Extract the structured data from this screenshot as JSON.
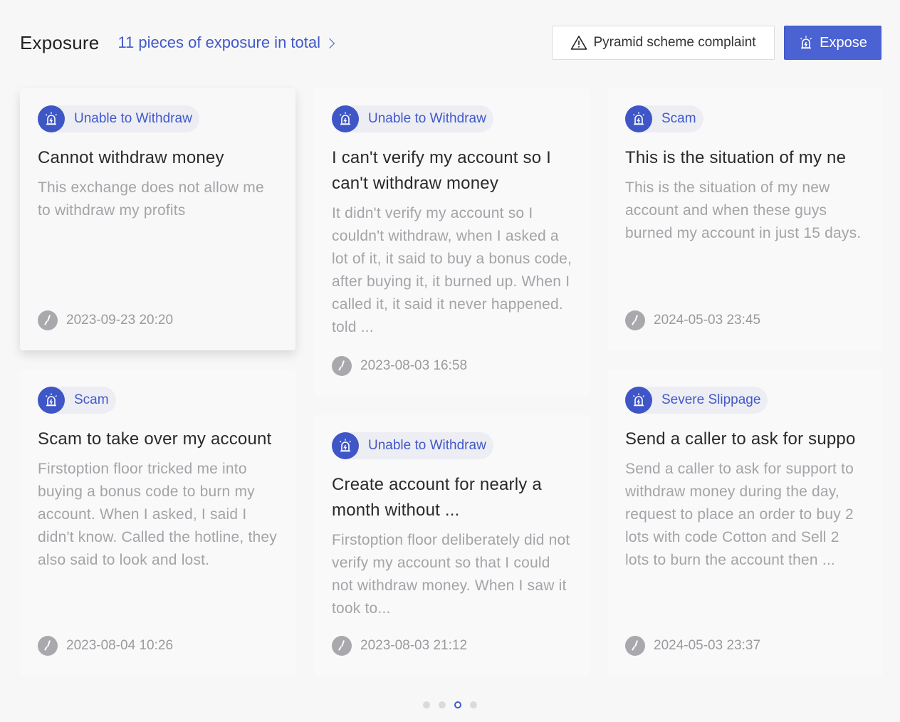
{
  "header": {
    "title": "Exposure",
    "total_link": "11 pieces of exposure in total",
    "complaint_button": "Pyramid scheme complaint",
    "expose_button": "Expose"
  },
  "cards": [
    {
      "tag": "Unable to Withdraw",
      "title": "Cannot withdraw money",
      "desc": "This exchange does not allow me to withdraw my profits",
      "time": "2023-09-23 20:20"
    },
    {
      "tag": "Scam",
      "title": "Scam to take over my account",
      "desc": "Firstoption floor tricked me into buying a bonus code to burn my account. When I asked, I said I didn't know. Called the hotline, they also said to look and lost.",
      "time": "2023-08-04 10:26"
    },
    {
      "tag": "Unable to Withdraw",
      "title": "I can't verify my account so I can't withdraw money",
      "desc": "It didn't verify my account so I couldn't withdraw, when I asked a lot of it, it said to buy a bonus code, after buying it, it burned up. When I called it, it said it never happened. told ...",
      "time": "2023-08-03 16:58"
    },
    {
      "tag": "Unable to Withdraw",
      "title": "Create account for nearly a month without ...",
      "desc": "Firstoption floor deliberately did not verify my account so that I could not withdraw money. When I saw it took to...",
      "time": "2023-08-03 21:12"
    },
    {
      "tag": "Scam",
      "title": "This is the situation of my ne",
      "desc": "This is the situation of my new account and when these guys burned my account in just 15 days.",
      "time": "2024-05-03 23:45"
    },
    {
      "tag": "Severe Slippage",
      "title": "Send a caller to ask for suppo",
      "desc": "Send a caller to ask for support to withdraw money during the day, request to place an order to buy 2 lots with code Cotton and Sell 2 lots to burn the account then ...",
      "time": "2024-05-03 23:37"
    }
  ],
  "pagination": {
    "pages": 4,
    "active_page": 3
  },
  "colors": {
    "accent": "#4159c9",
    "tag_bg": "#ededf4",
    "button_primary": "#4a62d2"
  }
}
